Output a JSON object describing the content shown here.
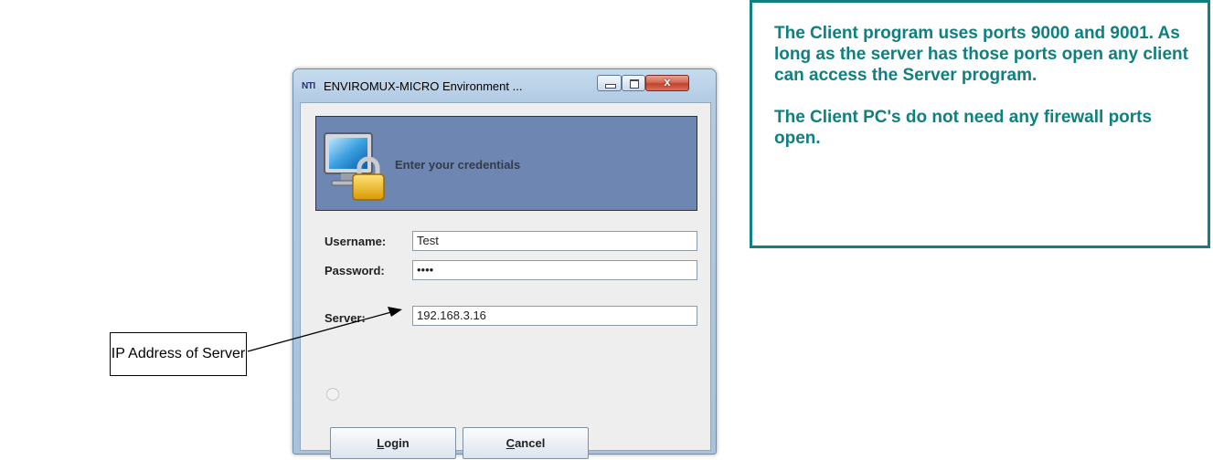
{
  "window": {
    "app_icon_text": "NTI",
    "title": "ENVIROMUX-MICRO Environment ...",
    "controls": {
      "minimize": "minimize",
      "maximize": "maximize",
      "close": "x"
    }
  },
  "banner": {
    "icon": "monitor-lock-icon",
    "text": "Enter your credentials",
    "color": "#6d87b2"
  },
  "form": {
    "username_label": "Username:",
    "username_value": "Test",
    "password_label": "Password:",
    "password_value": "••••",
    "server_label": "Server:",
    "server_value": "192.168.3.16"
  },
  "buttons": {
    "login_mnemonic": "L",
    "login_rest": "ogin",
    "cancel_mnemonic": "C",
    "cancel_rest": "ancel"
  },
  "callouts": {
    "ip_label": "IP Address of Server",
    "info_paragraphs": [
      "The Client program uses ports 9000 and 9001.  As long as the server has those ports open any client can access the Server program.",
      "The Client PC's do not need any firewall ports open."
    ],
    "info_color": "#0f7f7f"
  }
}
